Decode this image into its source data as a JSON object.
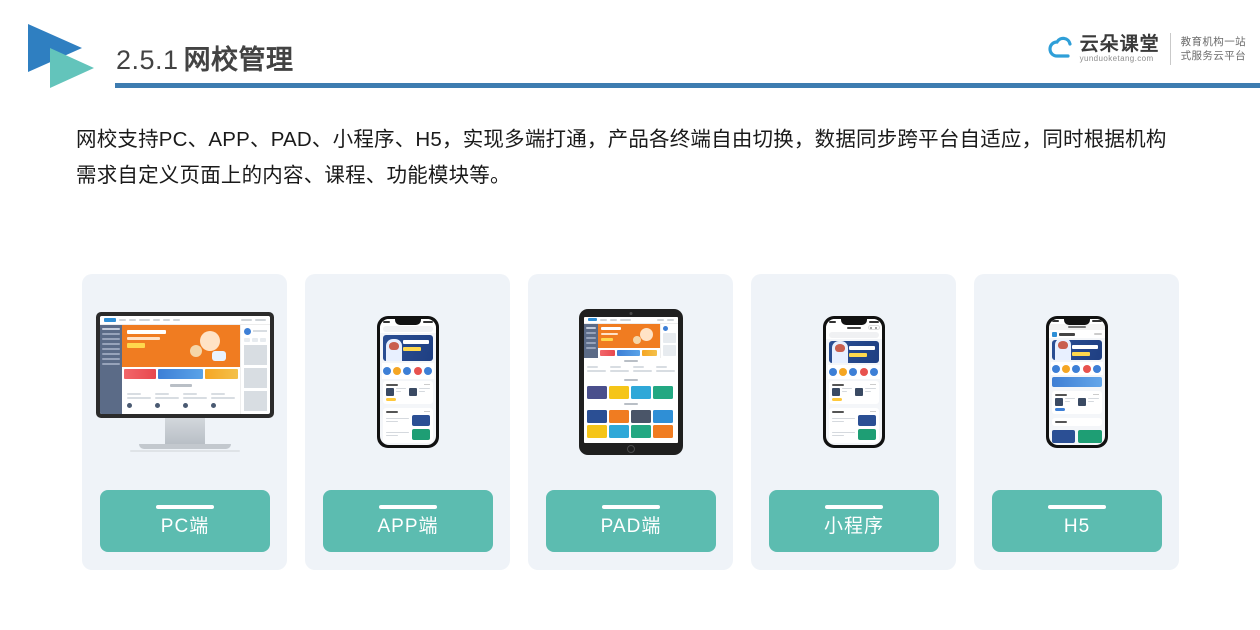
{
  "header": {
    "logo_icon": "double-arrow-logo",
    "section_number": "2.5.1",
    "section_title": "网校管理",
    "rule_color": "#3d7cb0"
  },
  "brand": {
    "cloud_icon": "cloud-icon",
    "name_cn": "云朵课堂",
    "name_en": "yunduoketang.com",
    "tagline_line1": "教育机构一站",
    "tagline_line2": "式服务云平台"
  },
  "body": {
    "paragraph": "网校支持PC、APP、PAD、小程序、H5，实现多端打通，产品各终端自由切换，数据同步跨平台自适应，同时根据机构需求自定义页面上的内容、课程、功能模块等。"
  },
  "cards": [
    {
      "label": "PC端",
      "device": "desktop-monitor"
    },
    {
      "label": "APP端",
      "device": "smartphone"
    },
    {
      "label": "PAD端",
      "device": "tablet"
    },
    {
      "label": "小程序",
      "device": "smartphone-miniprogram"
    },
    {
      "label": "H5",
      "device": "smartphone-browser"
    }
  ],
  "colors": {
    "accent_teal": "#5cbcb0",
    "rule_blue": "#3d7cb0",
    "card_bg": "#eff3f8",
    "logo_blue": "#2f7fc1",
    "logo_teal": "#63c4bb",
    "hero_orange": "#f07c21",
    "text_dark": "#1a1a1a"
  }
}
